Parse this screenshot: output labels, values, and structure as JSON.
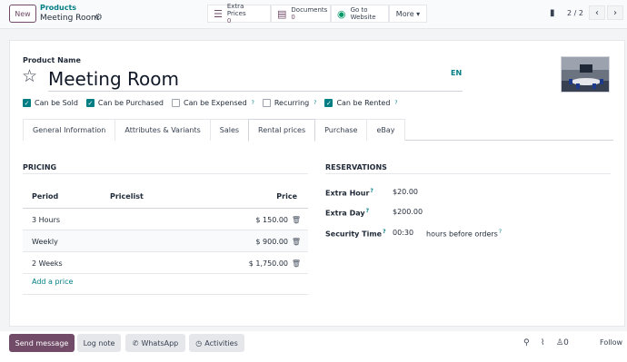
{
  "topbar": {
    "new_label": "New",
    "breadcrumb_parent": "Products",
    "breadcrumb_current": "Meeting Room",
    "smart_buttons": [
      {
        "label": "Extra Prices",
        "value": "0",
        "icon": "list-icon"
      },
      {
        "label": "Documents",
        "value": "0",
        "icon": "document-icon"
      },
      {
        "label": "Go to",
        "value": "Website",
        "icon": "globe-icon"
      }
    ],
    "more_label": "More ▾",
    "pager": "2 / 2"
  },
  "form": {
    "name_label": "Product Name",
    "product_name": "Meeting Room",
    "lang": "EN",
    "checkboxes": [
      {
        "label": "Can be Sold",
        "checked": true,
        "help": false
      },
      {
        "label": "Can be Purchased",
        "checked": true,
        "help": false
      },
      {
        "label": "Can be Expensed",
        "checked": false,
        "help": true
      },
      {
        "label": "Recurring",
        "checked": false,
        "help": true
      },
      {
        "label": "Can be Rented",
        "checked": true,
        "help": true
      }
    ],
    "tabs": [
      "General Information",
      "Attributes & Variants",
      "Sales",
      "Rental prices",
      "Purchase",
      "eBay"
    ],
    "active_tab": "Rental prices"
  },
  "pricing": {
    "title": "PRICING",
    "headers": {
      "period": "Period",
      "pricelist": "Pricelist",
      "price": "Price"
    },
    "rows": [
      {
        "period": "3 Hours",
        "pricelist": "",
        "price": "$ 150.00"
      },
      {
        "period": "Weekly",
        "pricelist": "",
        "price": "$ 900.00"
      },
      {
        "period": "2 Weeks",
        "pricelist": "",
        "price": "$ 1,750.00"
      }
    ],
    "add_label": "Add a price"
  },
  "reservations": {
    "title": "RESERVATIONS",
    "extra_hour_label": "Extra Hour",
    "extra_hour_value": "$20.00",
    "extra_day_label": "Extra Day",
    "extra_day_value": "$200.00",
    "security_label": "Security Time",
    "security_value": "00:30",
    "security_suffix": "hours before orders"
  },
  "chatter": {
    "send_message": "Send message",
    "log_note": "Log note",
    "whatsapp": "WhatsApp",
    "activities": "Activities",
    "followers_count": "0",
    "follow": "Follow"
  },
  "colors": {
    "brand": "#714B67",
    "accent": "#017e84"
  }
}
